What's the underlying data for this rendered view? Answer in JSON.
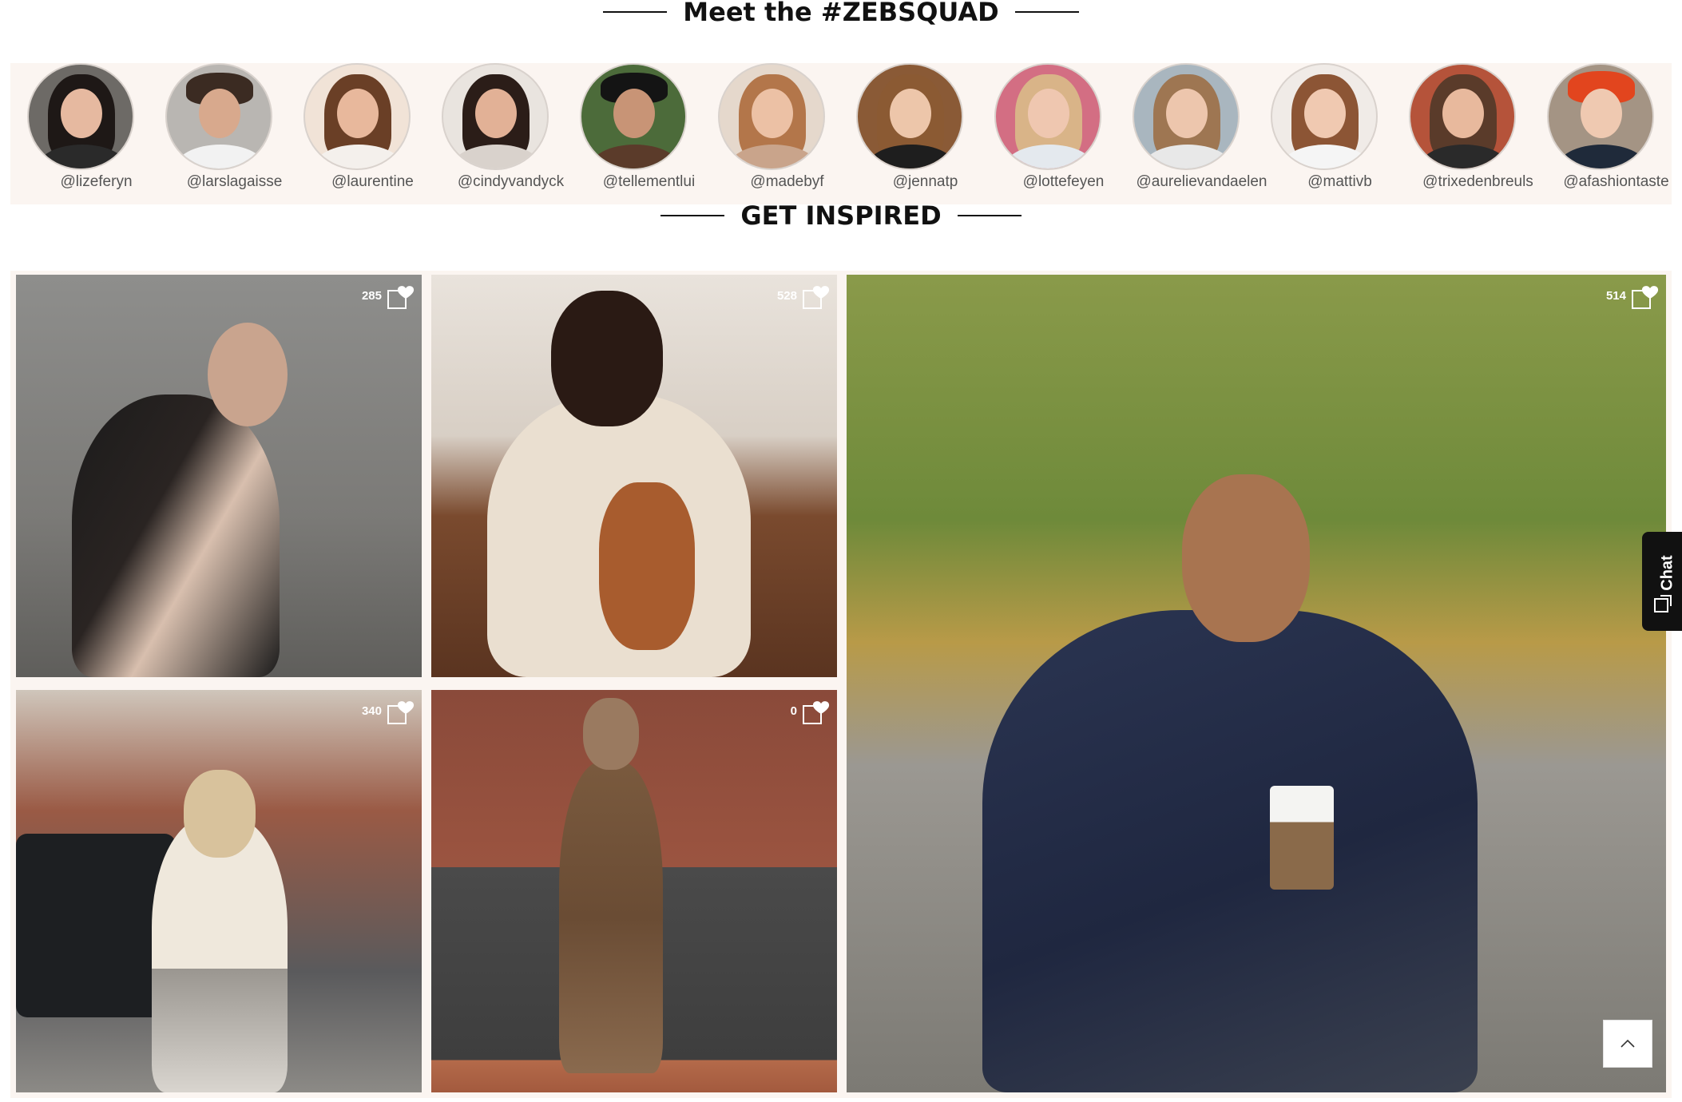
{
  "squad": {
    "title": "Meet the #ZEBSQUAD",
    "members": [
      {
        "handle": "@lizeferyn"
      },
      {
        "handle": "@larslagaisse"
      },
      {
        "handle": "@laurentine"
      },
      {
        "handle": "@cindyvandyck"
      },
      {
        "handle": "@tellementlui"
      },
      {
        "handle": "@madebyf"
      },
      {
        "handle": "@jennatp"
      },
      {
        "handle": "@lottefeyen"
      },
      {
        "handle": "@aurelievandaelen"
      },
      {
        "handle": "@mattivb"
      },
      {
        "handle": "@trixedenbreuls"
      },
      {
        "handle": "@afashiontaste"
      }
    ]
  },
  "inspired": {
    "title": "GET INSPIRED",
    "posts": [
      {
        "likes": "285",
        "icon": "heart-icon"
      },
      {
        "likes": "528",
        "icon": "heart-icon"
      },
      {
        "likes": "514",
        "icon": "heart-icon"
      },
      {
        "likes": "340",
        "icon": "heart-icon"
      },
      {
        "likes": "0",
        "icon": "heart-icon"
      }
    ]
  },
  "chat": {
    "label": "Chat",
    "icon": "chat-bubble-icon"
  },
  "scroll_top": {
    "icon": "chevron-up-icon"
  }
}
